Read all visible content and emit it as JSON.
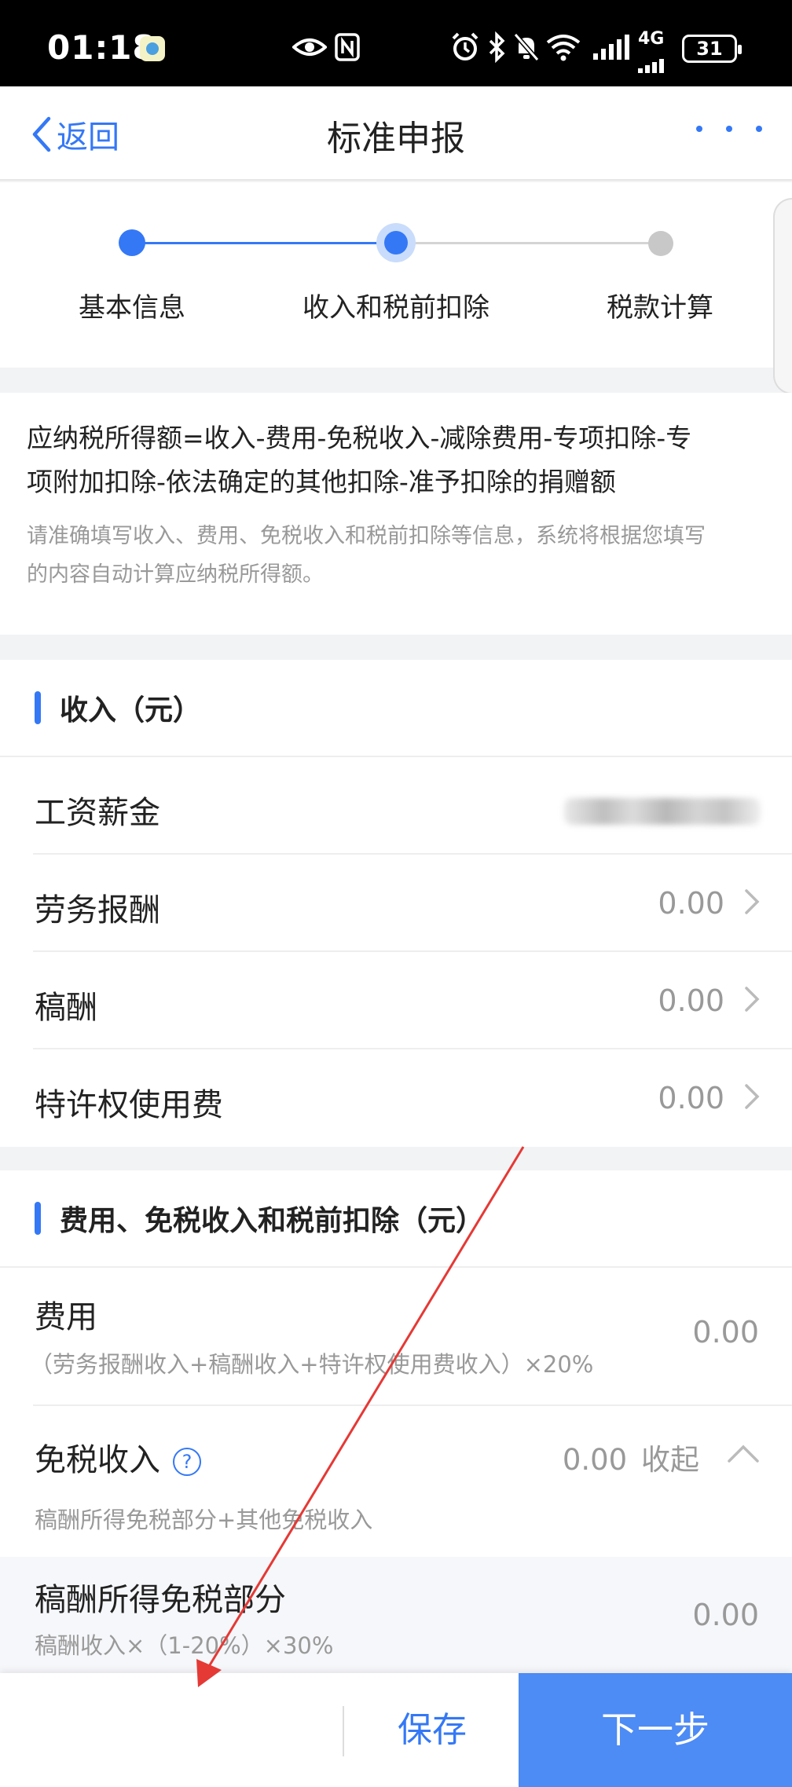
{
  "status_bar": {
    "time": "01:18",
    "battery": "31",
    "network": "4G",
    "icons": [
      "eye-icon",
      "nfc-icon",
      "alarm-icon",
      "bluetooth-icon",
      "mute-icon",
      "wifi-icon",
      "signal-icon"
    ]
  },
  "nav": {
    "back_label": "返回",
    "title": "标准申报"
  },
  "stepper": {
    "steps": [
      {
        "label": "基本信息",
        "state": "done"
      },
      {
        "label": "收入和税前扣除",
        "state": "current"
      },
      {
        "label": "税款计算",
        "state": "pending"
      }
    ],
    "colors": {
      "active": "#3478f6",
      "pending": "#c8c8c8"
    }
  },
  "formula": {
    "line1": "应纳税所得额=收入-费用-免税收入-减除费用-专项扣除-专",
    "line2": "项附加扣除-依法确定的其他扣除-准予扣除的捐赠额",
    "note1": "请准确填写收入、费用、免税收入和税前扣除等信息，系统将根据您填写",
    "note2": "的内容自动计算应纳税所得额。"
  },
  "income": {
    "title": "收入（元）",
    "rows": [
      {
        "label": "工资薪金",
        "value": "",
        "blurred": true
      },
      {
        "label": "劳务报酬",
        "value": "0.00"
      },
      {
        "label": "稿酬",
        "value": "0.00"
      },
      {
        "label": "特许权使用费",
        "value": "0.00"
      }
    ]
  },
  "deductions": {
    "title": "费用、免税收入和税前扣除（元）",
    "fee": {
      "label": "费用",
      "sub": "（劳务报酬收入+稿酬收入+特许权使用费收入）×20%",
      "value": "0.00"
    },
    "tax_free": {
      "label": "免税收入",
      "value": "0.00",
      "toggle": "收起",
      "sub": "稿酬所得免税部分+其他免税收入"
    },
    "royalty_exempt": {
      "label": "稿酬所得免税部分",
      "sub": "稿酬收入×（1-20%）×30%",
      "value": "0.00"
    }
  },
  "bottom": {
    "save": "保存",
    "next": "下一步"
  },
  "theme": {
    "accent": "#3478f6",
    "annotation_arrow": "#e53935"
  }
}
